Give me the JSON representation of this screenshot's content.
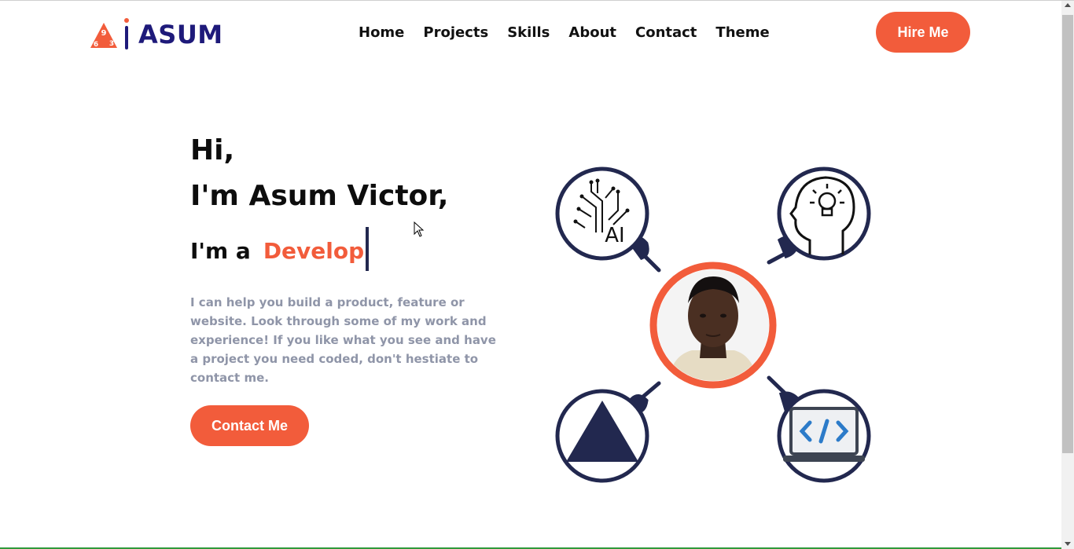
{
  "brand": {
    "logo_digits": [
      "9",
      "6",
      "3"
    ],
    "name": "ASUM"
  },
  "nav": {
    "items": [
      {
        "label": "Home"
      },
      {
        "label": "Projects"
      },
      {
        "label": "Skills"
      },
      {
        "label": "About"
      },
      {
        "label": "Contact"
      },
      {
        "label": "Theme"
      }
    ]
  },
  "header": {
    "hire_label": "Hire Me"
  },
  "hero": {
    "greeting": "Hi,",
    "name_line": "I'm Asum Victor,",
    "role_prefix": "I'm a",
    "role_typed": "Develop",
    "description": "I can help you build a product, feature or website. Look through some of my work and experience! If you like what you see and have a project you need coded, don't hestiate to contact me.",
    "contact_label": "Contact Me"
  },
  "graphic": {
    "ai_text": "AI",
    "icons": [
      "ai-circuit-icon",
      "lightbulb-head-icon",
      "triangle-icon",
      "code-laptop-icon"
    ]
  },
  "colors": {
    "accent": "#f25c3b",
    "brand_navy": "#1e1a7a",
    "ring_navy": "#22284f",
    "muted_text": "#8f95a8"
  }
}
